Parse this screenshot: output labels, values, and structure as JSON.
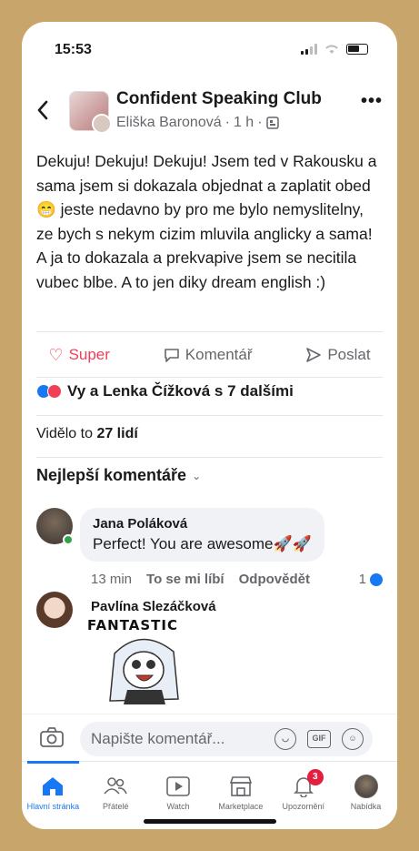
{
  "status_bar": {
    "time": "15:53"
  },
  "post": {
    "group_name": "Confident Speaking Club",
    "author": "Eliška Baronová",
    "age": "1 h",
    "text": "Dekuju! Dekuju! Dekuju! Jsem ted v Rakousku a sama jsem si dokazala objednat a zaplatit obed 😁 jeste nedavno by pro me bylo nemyslitelny, ze bych s nekym cizim mluvila anglicky a sama! A ja to dokazala a prekvapive jsem se necitila vubec blbe. A to jen diky dream english :)",
    "actions": {
      "super": "Super",
      "comment": "Komentář",
      "share": "Poslat"
    },
    "reactions_text": "Vy a Lenka Čížková s 7 dalšími",
    "seen_prefix": "Vidělo to",
    "seen_count": "27 lidí"
  },
  "comments_section": {
    "header": "Nejlepší komentáře",
    "comments": [
      {
        "name": "Jana Poláková",
        "text": "Perfect! You are awesome🚀🚀",
        "time": "13 min",
        "like": "To se mi líbí",
        "reply": "Odpovědět",
        "reaction_count": "1"
      },
      {
        "name": "Pavlína Slezáčková",
        "sticker_text": "FANTASTIC"
      }
    ]
  },
  "composer": {
    "placeholder": "Napište komentář...",
    "gif": "GIF"
  },
  "tabbar": {
    "tabs": [
      {
        "label": "Hlavní stránka",
        "icon": "home-icon"
      },
      {
        "label": "Přátelé",
        "icon": "friends-icon"
      },
      {
        "label": "Watch",
        "icon": "watch-icon"
      },
      {
        "label": "Marketplace",
        "icon": "marketplace-icon"
      },
      {
        "label": "Upozornění",
        "icon": "bell-icon",
        "badge": "3"
      },
      {
        "label": "Nabídka",
        "icon": "menu-avatar-icon"
      }
    ]
  },
  "colors": {
    "frame": "#c8a56a",
    "accent": "#1877f2",
    "love": "#f33e58"
  }
}
